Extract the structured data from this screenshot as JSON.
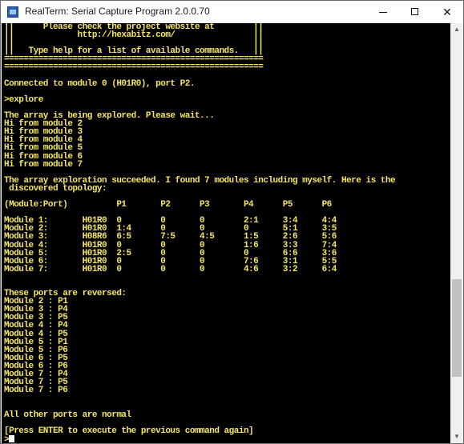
{
  "window": {
    "title": "RealTerm: Serial Capture Program 2.0.0.70",
    "minimize_icon": "minimize-icon",
    "maximize_icon": "maximize-icon",
    "close_glyph": "✕"
  },
  "scrollbar": {
    "up_glyph": "▲",
    "down_glyph": "▼",
    "position_fraction": 0.82
  },
  "colors": {
    "background": "#000000",
    "text": "#f5e663",
    "cursor": "#ffffff"
  },
  "terminal": {
    "lines": [
      "||      Please check the project website at        ||",
      "||             http://hexabitz.com/                ||",
      "||                                                 ||",
      "||   Type help for a list of available commands.   ||",
      "=====================================================",
      "=====================================================",
      "",
      "Connected to module 0 (H01R0), port P2.",
      "",
      ">explore",
      "",
      "The array is being explored. Please wait...",
      "Hi from module 2",
      "Hi from module 3",
      "Hi from module 4",
      "Hi from module 5",
      "Hi from module 6",
      "Hi from module 7",
      "",
      "The array exploration succeeded. I found 7 modules including myself. Here is the",
      " discovered topology:",
      "",
      "(Module:Port)          P1       P2      P3       P4      P5      P6",
      "",
      "Module 1:       H01R0  0        0       0        2:1     3:4     4:4",
      "Module 2:       H01R0  1:4      0       0        0       5:1     3:5",
      "Module 3:       H08R6  6:5      7:5     4:5      1:5     2:6     5:6",
      "Module 4:       H01R0  0        0       0        1:6     3:3     7:4",
      "Module 5:       H01R0  2:5      0       0        0       6:6     3:6",
      "Module 6:       H01R0  0        0       0        7:6     3:1     5:5",
      "Module 7:       H01R0  0        0       0        4:6     3:2     6:4",
      "",
      "",
      "These ports are reversed:",
      "Module 2 : P1",
      "Module 3 : P4",
      "Module 3 : P5",
      "Module 4 : P4",
      "Module 4 : P5",
      "Module 5 : P1",
      "Module 5 : P6",
      "Module 6 : P5",
      "Module 6 : P6",
      "Module 7 : P4",
      "Module 7 : P5",
      "Module 7 : P6",
      "",
      "",
      "All other ports are normal",
      "",
      "[Press ENTER to execute the previous command again]",
      ">"
    ]
  }
}
